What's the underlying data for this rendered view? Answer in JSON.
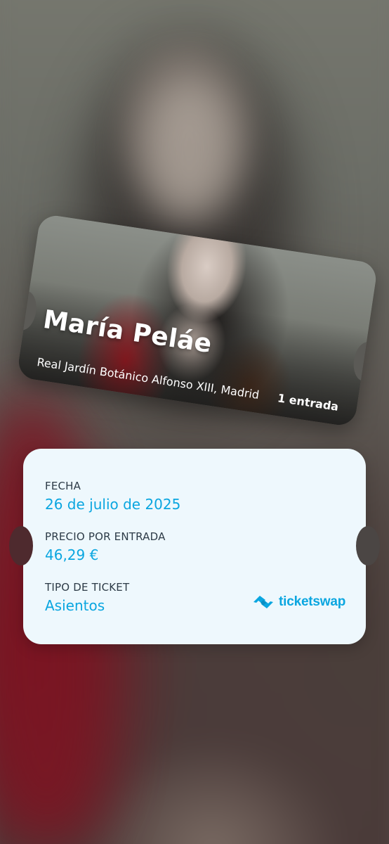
{
  "ticket": {
    "artist": "María Peláe",
    "venue": "Real Jardín Botánico Alfonso XIII, Madrid",
    "quantity": "1 entrada"
  },
  "details": {
    "date_label": "FECHA",
    "date_value": "26 de julio de 2025",
    "price_label": "PRECIO POR ENTRADA",
    "price_value": "46,29 €",
    "type_label": "TIPO DE TICKET",
    "type_value": "Asientos"
  },
  "brand": {
    "name": "ticketswap",
    "icon": "ticketswap-logo-icon",
    "color": "#0aa6e0"
  },
  "colors": {
    "label": "#2d3b47",
    "accent": "#0aa6e0",
    "card_bg": "#eef8fd"
  }
}
